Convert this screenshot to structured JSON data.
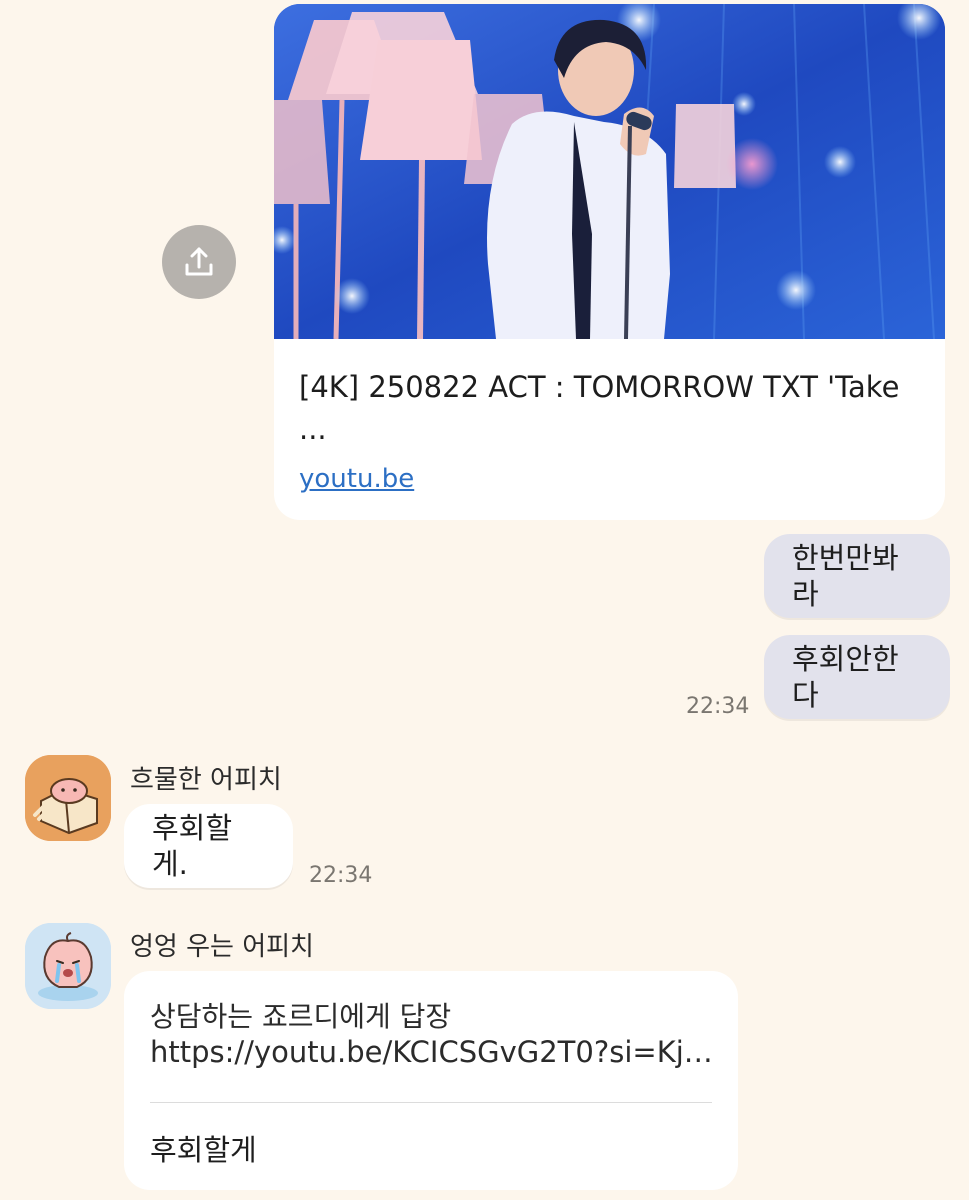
{
  "link_preview": {
    "title": "[4K] 250822 ACT : TOMORROW TXT 'Take ...",
    "domain": "youtu.be",
    "thumbnail_icon": "concert-photo",
    "share_icon": "share-upload-icon"
  },
  "my_messages": [
    {
      "text": "한번만봐라"
    },
    {
      "text": "후회안한다"
    }
  ],
  "my_time": "22:34",
  "other_messages": [
    {
      "sender": "흐물한 어피치",
      "text": "후회할게.",
      "time": "22:34"
    },
    {
      "sender": "엉엉 우는 어피치",
      "reply_title": "상담하는 죠르디에게 답장",
      "reply_url": "https://youtu.be/KCICSGvG2T0?si=Kj…",
      "text": "후회할게"
    }
  ],
  "colors": {
    "background": "#fdf6ec",
    "my_bubble": "#e2e2ec",
    "other_bubble": "#ffffff",
    "link": "#2c6fc4"
  }
}
